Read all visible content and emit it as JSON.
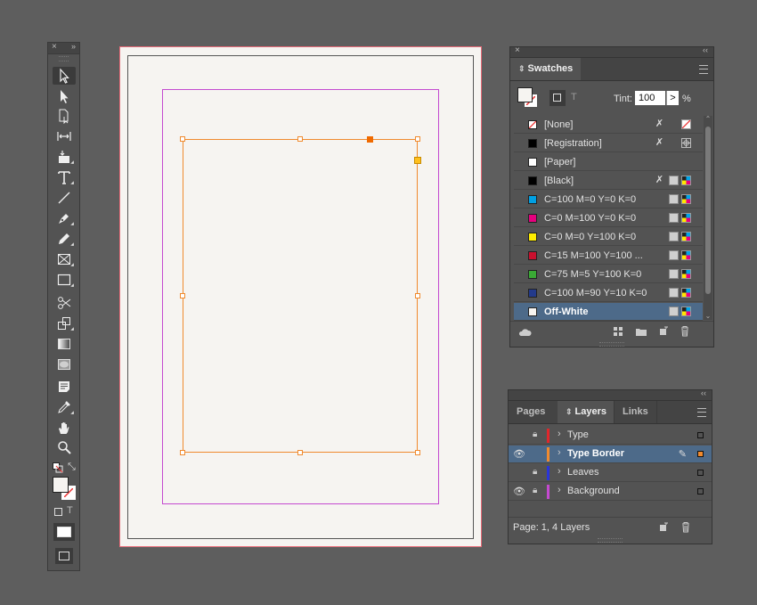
{
  "tools_panel": {
    "close_glyph": "×",
    "collapse_glyph": "»",
    "tools": [
      {
        "name": "selection-tool-icon",
        "selected": true
      },
      {
        "name": "direct-selection-tool-icon"
      },
      {
        "name": "page-tool-icon"
      },
      {
        "name": "gap-tool-icon"
      },
      {
        "name": "content-collector-tool-icon"
      },
      {
        "name": "type-tool-icon"
      },
      {
        "name": "line-tool-icon"
      },
      {
        "name": "pen-tool-icon"
      },
      {
        "name": "pencil-tool-icon"
      },
      {
        "name": "rectangle-frame-tool-icon"
      },
      {
        "name": "rectangle-tool-icon"
      },
      {
        "name": "scissors-tool-icon"
      },
      {
        "name": "free-transform-tool-icon"
      },
      {
        "name": "gradient-swatch-tool-icon"
      },
      {
        "name": "gradient-feather-tool-icon"
      },
      {
        "name": "note-tool-icon"
      },
      {
        "name": "eyedropper-tool-icon"
      },
      {
        "name": "hand-tool-icon"
      },
      {
        "name": "zoom-tool-icon"
      }
    ]
  },
  "swatches_panel": {
    "title": "Swatches",
    "tint_label": "Tint:",
    "tint_value": "100",
    "tint_unit": "%",
    "tint_arrow": ">",
    "format_text_glyph": "T",
    "swatches": [
      {
        "name": "[None]",
        "color": "none"
      },
      {
        "name": "[Registration]",
        "color": "#000000"
      },
      {
        "name": "[Paper]",
        "color": "#ffffff"
      },
      {
        "name": "[Black]",
        "color": "#000000"
      },
      {
        "name": "C=100 M=0 Y=0 K=0",
        "color": "#00a0e3"
      },
      {
        "name": "C=0 M=100 Y=0 K=0",
        "color": "#e6007e"
      },
      {
        "name": "C=0 M=0 Y=100 K=0",
        "color": "#ffed00"
      },
      {
        "name": "C=15 M=100 Y=100 ...",
        "color": "#c8102e"
      },
      {
        "name": "C=75 M=5 Y=100 K=0",
        "color": "#3aaa35"
      },
      {
        "name": "C=100 M=90 Y=10 K=0",
        "color": "#233a8b"
      },
      {
        "name": "Off-White",
        "color": "#f6f4f1",
        "selected": true
      }
    ]
  },
  "layers_panel": {
    "tabs": [
      "Pages",
      "Layers",
      "Links"
    ],
    "active_tab": "Layers",
    "status": "Page: 1, 4 Layers",
    "layers": [
      {
        "name": "Type",
        "color": "#e0262b",
        "visible": false,
        "locked": true
      },
      {
        "name": "Type Border",
        "color": "#f08a2e",
        "visible": true,
        "locked": false,
        "selected": true
      },
      {
        "name": "Leaves",
        "color": "#2a35d8",
        "visible": false,
        "locked": true
      },
      {
        "name": "Background",
        "color": "#c44ad0",
        "visible": true,
        "locked": true
      }
    ]
  },
  "colors": {
    "accent_selection": "#4d6a89",
    "frame_orange": "#f08a2e",
    "margin_magenta": "#c44ad0",
    "bleed_red": "#e86b78"
  }
}
